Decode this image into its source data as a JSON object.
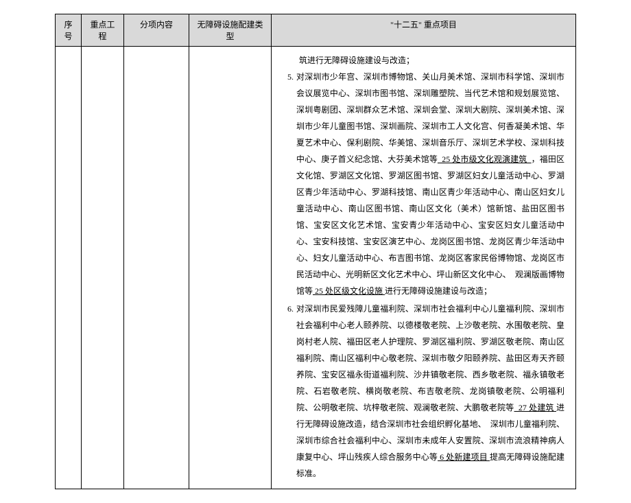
{
  "headers": {
    "col1": "序号",
    "col2": "重点工程",
    "col3": "分项内容",
    "col4": "无障碍设施配建类型",
    "col5": "\"十二五\" 重点项目"
  },
  "content": {
    "lead": "筑进行无障碍设施建设与改造；",
    "item5": {
      "num": "5.",
      "text_a": "对深圳市少年宫、深圳市博物馆、关山月美术馆、深圳市科学馆、深圳市会议展览中心、深圳市图书馆、深圳雕塑院、当代艺术馆和规划展览馆、深圳粤剧团、深圳群众艺术馆、深圳会堂、深圳大剧院、深圳美术馆、深圳市少年儿童图书馆、深圳画院、深圳市工人文化宫、何香凝美术馆、华夏艺术中心、保利剧院、华美馆、深圳音乐厅、深圳艺术学校、深圳科技中心、庚子首义纪念馆、大芬美术馆等",
      "u1": "  25 处市级文化观演建筑  ",
      "text_b": "，福田区文化馆、罗湖区文化馆、罗湖区图书馆、罗湖区妇女儿童活动中心、罗湖区青少年活动中心、罗湖科技馆、南山区青少年活动中心、南山区妇女儿童活动中心、南山区图书馆、南山区文化（美术）馆新馆、盐田区图书馆、宝安区文化艺术馆、宝安青少年活动中心、宝安区妇女儿童活动中心、宝安科技馆、宝安区演艺中心、龙岗区图书馆、龙岗区青少年活动中心、妇女儿童活动中心、布吉图书馆、龙岗区客家民俗博物馆、龙岗区市民活动中心、光明新区文化艺术中心、坪山新区文化中心、  观澜版画博物馆等",
      "u2": " 25 处区级文化设施 ",
      "text_c": "进行无障碍设施建设与改造；"
    },
    "item6": {
      "num": "6.",
      "text_a": "对深圳市民爱残障儿童福利院、深圳市社会福利中心儿童福利院、深圳市社会福利中心老人颐养院、以德楼敬老院、上沙敬老院、水围敬老院、皇岗村老人院、福田区老人护理院、罗湖区福利院、罗湖区敬老院、南山区福利院、南山区福利中心敬老院、深圳市敬夕阳颐养院、盐田区寿天齐颐养院、宝安区福永街道福利院、沙井镇敬老院、西乡敬老院、福永镇敬老院、石岩敬老院、横岗敬老院、布吉敬老院、龙岗镇敬老院、公明福利院、公明敬老院、坑梓敬老院、观澜敬老院、大鹏敬老院等",
      "u1": "  27 处建筑 ",
      "text_b": "进行无障碍设施改造，结合深圳市社会组织孵化基地、  深圳市儿童福利院、深圳市综合社会福利中心、深圳市未成年人安置院、深圳市流浪精神病人康复中心、坪山残疾人综合服务中心等",
      "u2": " 6 处新建项目 ",
      "text_c": "提高无障碍设施配建标准。"
    }
  }
}
